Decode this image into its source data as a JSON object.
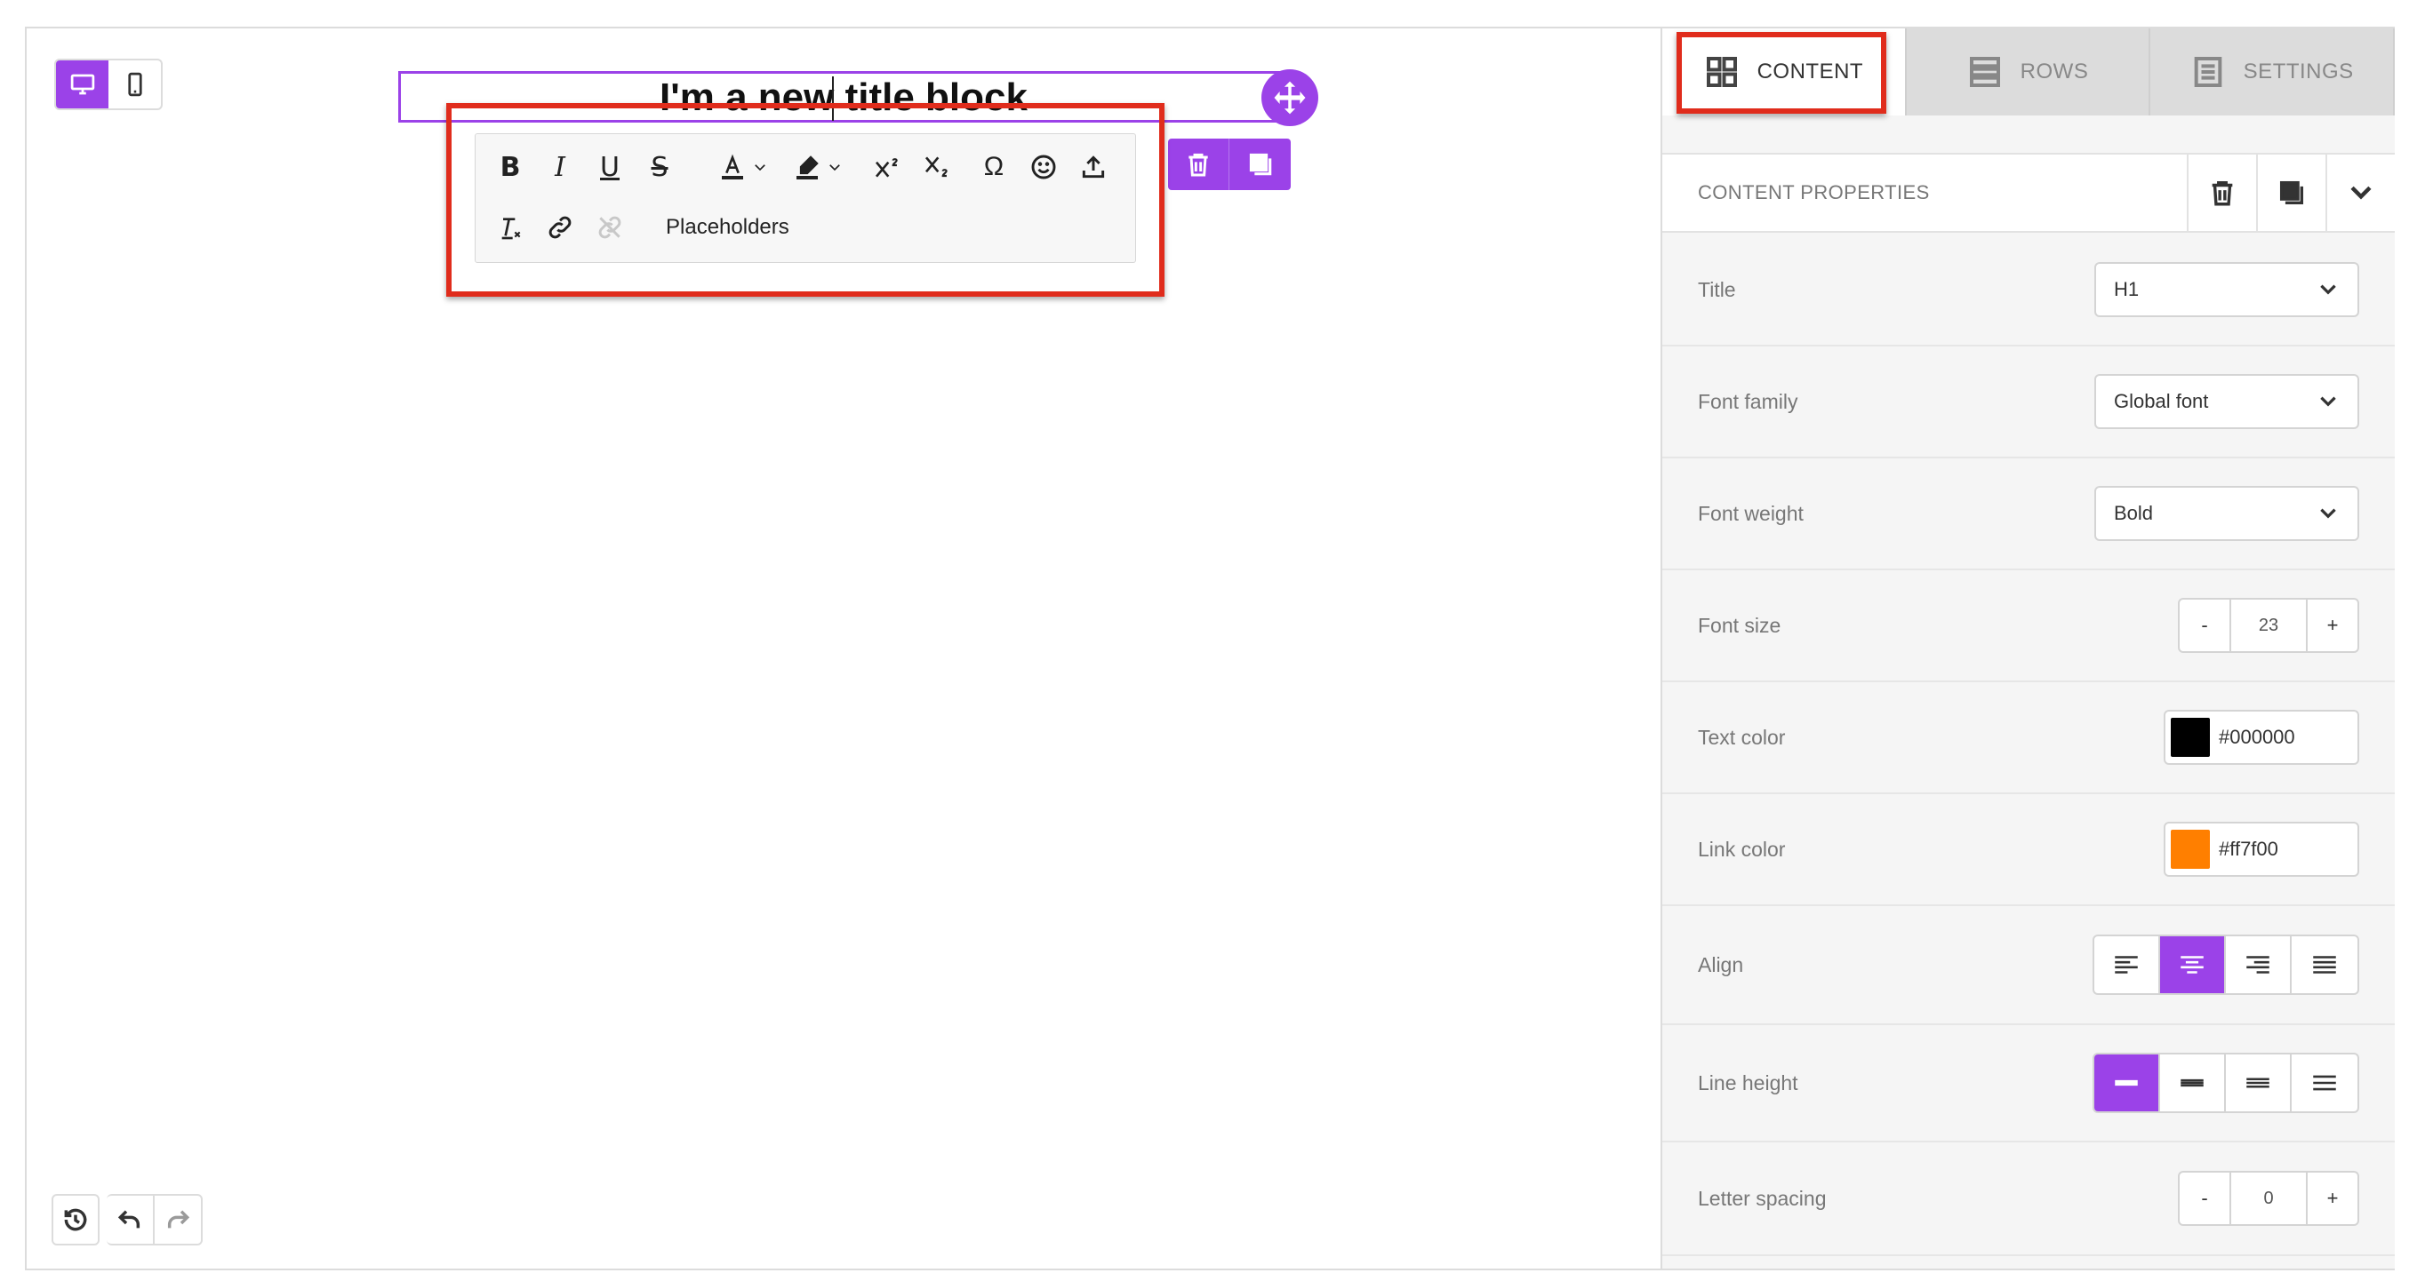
{
  "canvas": {
    "title_text": "I'm a new title block",
    "toolbar": {
      "bold_label": "B",
      "italic_label": "I",
      "underline_label": "U",
      "strike_label": "S",
      "special_char_label": "Ω",
      "placeholders_label": "Placeholders"
    },
    "view_modes": [
      "desktop",
      "mobile"
    ],
    "active_view": "desktop"
  },
  "tabs": [
    {
      "label": "CONTENT",
      "icon": "grid-icon",
      "active": true
    },
    {
      "label": "ROWS",
      "icon": "rows-icon",
      "active": false
    },
    {
      "label": "SETTINGS",
      "icon": "settings-doc-icon",
      "active": false
    }
  ],
  "properties": {
    "header": "CONTENT PROPERTIES",
    "title": {
      "label": "Title",
      "value": "H1"
    },
    "font_family": {
      "label": "Font family",
      "value": "Global font"
    },
    "font_weight": {
      "label": "Font weight",
      "value": "Bold"
    },
    "font_size": {
      "label": "Font size",
      "value": "23",
      "minus": "-",
      "plus": "+"
    },
    "text_color": {
      "label": "Text color",
      "value": "#000000",
      "swatch": "#000000"
    },
    "link_color": {
      "label": "Link color",
      "value": "#ff7f00",
      "swatch": "#ff7f00"
    },
    "align": {
      "label": "Align",
      "options": [
        "left",
        "center",
        "right",
        "justify"
      ],
      "selected": "center"
    },
    "line_height": {
      "label": "Line height",
      "options": [
        "tight",
        "normal",
        "loose",
        "looser"
      ],
      "selected": "tight"
    },
    "letter_spacing": {
      "label": "Letter spacing",
      "value": "0",
      "minus": "-",
      "plus": "+"
    }
  },
  "colors": {
    "accent": "#9b42e8",
    "highlight": "#e02c1c"
  }
}
